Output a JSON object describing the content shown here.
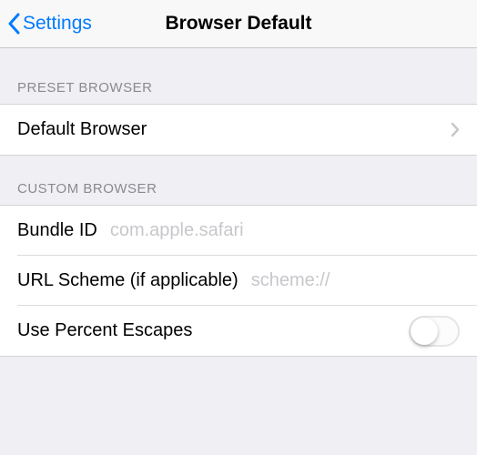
{
  "nav": {
    "back_label": "Settings",
    "title": "Browser Default"
  },
  "sections": {
    "preset": {
      "header": "PRESET BROWSER",
      "default_browser_label": "Default Browser"
    },
    "custom": {
      "header": "CUSTOM BROWSER",
      "bundle_id_label": "Bundle ID",
      "bundle_id_placeholder": "com.apple.safari",
      "bundle_id_value": "",
      "url_scheme_label": "URL Scheme (if applicable)",
      "url_scheme_placeholder": "scheme://",
      "url_scheme_value": "",
      "use_percent_escapes_label": "Use Percent Escapes",
      "use_percent_escapes_on": false
    }
  }
}
